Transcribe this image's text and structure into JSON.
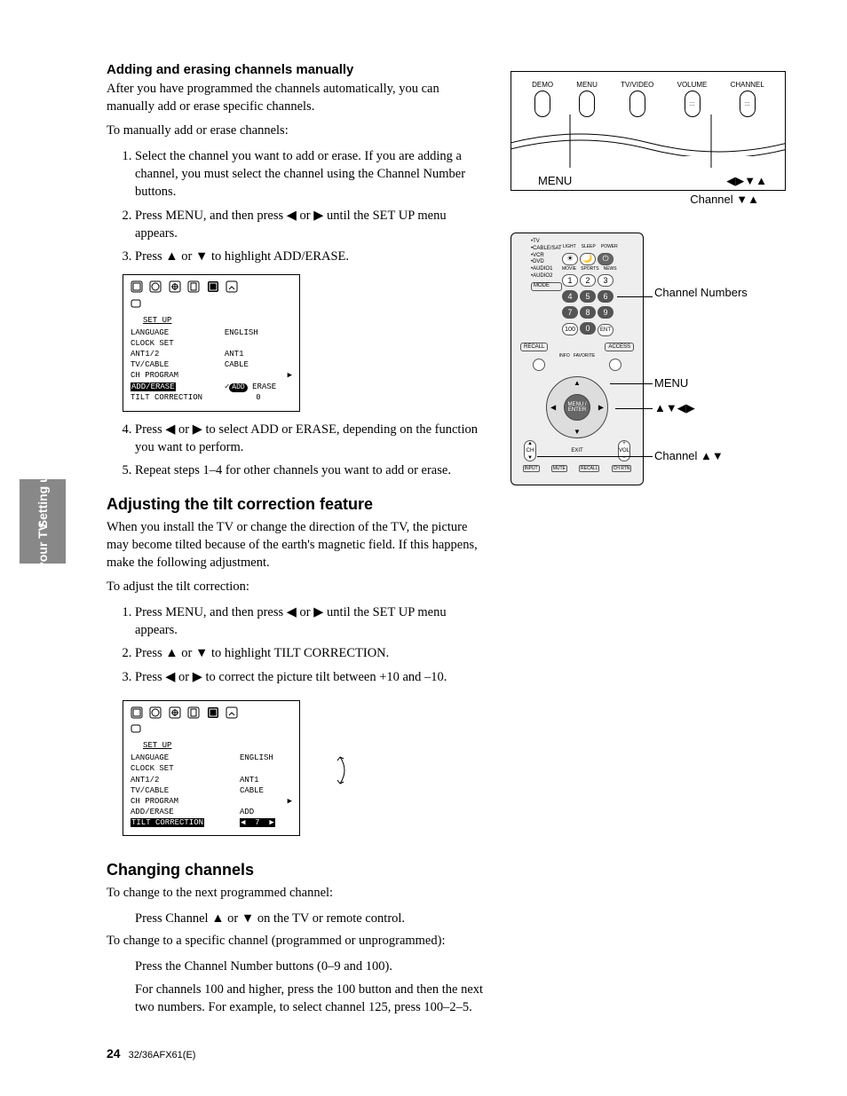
{
  "sideTab": {
    "line1": "Setting up",
    "line2": "your TV"
  },
  "sec1": {
    "heading": "Adding and erasing channels manually",
    "intro": "After you have programmed the channels automatically, you can manually add or erase specific channels.",
    "lead": "To manually add or erase channels:",
    "step1": "Select the channel you want to add or erase. If you are adding a channel, you must select the channel using the Channel Number buttons.",
    "step2a": "Press MENU, and then press ",
    "step2b": " or ",
    "step2c": " until the SET UP menu appears.",
    "step3a": "Press ",
    "step3b": " or ",
    "step3c": " to highlight ADD/ERASE.",
    "step4a": "Press ",
    "step4b": " or ",
    "step4c": " to select ADD or ERASE, depending on the function you want to perform.",
    "step5": "Repeat steps 1–4 for other channels you want to add or erase."
  },
  "osd1": {
    "title": "SET UP",
    "items": [
      {
        "l": "LANGUAGE",
        "r": "ENGLISH"
      },
      {
        "l": "CLOCK SET",
        "r": ""
      },
      {
        "l": "ANT1/2",
        "r": "ANT1"
      },
      {
        "l": "TV/CABLE",
        "r": "CABLE"
      },
      {
        "l": "CH PROGRAM",
        "r": "▶"
      }
    ],
    "hlRow": {
      "l": "ADD/ERASE",
      "a": "ADD",
      "b": "ERASE"
    },
    "last": {
      "l": "TILT CORRECTION",
      "r": "0"
    }
  },
  "sec2": {
    "heading": "Adjusting the tilt correction feature",
    "intro": "When you install the TV or change the direction of the TV, the picture may become tilted because of the earth's magnetic field. If this happens, make the following adjustment.",
    "lead": "To adjust the tilt correction:",
    "step1a": "Press MENU, and then press ",
    "step1b": " or ",
    "step1c": " until the SET UP menu appears.",
    "step2a": "Press ",
    "step2b": " or ",
    "step2c": " to highlight TILT CORRECTION.",
    "step3a": "Press ",
    "step3b": " or ",
    "step3c": " to correct the picture tilt between +10 and –10."
  },
  "osd2": {
    "title": "SET UP",
    "items": [
      {
        "l": "LANGUAGE",
        "r": "ENGLISH"
      },
      {
        "l": "CLOCK SET",
        "r": ""
      },
      {
        "l": "ANT1/2",
        "r": "ANT1"
      },
      {
        "l": "TV/CABLE",
        "r": "CABLE"
      },
      {
        "l": "CH PROGRAM",
        "r": "▶"
      },
      {
        "l": "ADD/ERASE",
        "r": "ADD"
      }
    ],
    "hlRow": {
      "l": "TILT CORRECTION",
      "r": "7"
    }
  },
  "sec3": {
    "heading": "Changing channels",
    "p1": "To change to the next programmed channel:",
    "i1a": "Press Channel ",
    "i1b": " or ",
    "i1c": " on the TV or remote control.",
    "p2": "To change to a specific channel (programmed or unprogrammed):",
    "i2": "Press the Channel Number buttons (0–9 and 100).",
    "i3": "For channels 100 and higher, press the 100 button and then the next two numbers. For example, to select channel 125, press 100–2–5."
  },
  "tvDiagram": {
    "buttons": [
      "DEMO",
      "MENU",
      "TV/VIDEO",
      "VOLUME",
      "CHANNEL"
    ],
    "labelLeft": "MENU",
    "labelRightArrows": "◀▶▼▲",
    "labelRightCh": "Channel ▼▲"
  },
  "remoteDiagram": {
    "sideLabels": [
      "•TV",
      "•CABLE/SAT",
      "•VCR",
      "•DVD",
      "•AUDIO1",
      "•AUDIO2"
    ],
    "mode": "MODE",
    "topRow": [
      "LIGHT",
      "SLEEP",
      "⏻"
    ],
    "topRowSub": [
      "MOVIE",
      "SPORTS",
      "NEWS"
    ],
    "nums": [
      "1",
      "2",
      "3",
      "4",
      "5",
      "6",
      "7",
      "8",
      "9",
      "100",
      "0",
      "ENT"
    ],
    "mid": [
      "RECALL",
      "ACCESS"
    ],
    "ringCenter": "MENU / ENTER",
    "lowerBtns": [
      "CH",
      "EXIT",
      "VOL"
    ],
    "bottomRow": [
      "INPUT",
      "MUTE",
      "RECALL",
      "CH RTN"
    ],
    "annot1": "Channel Numbers",
    "annot2": "MENU",
    "annot3": "▲▼◀▶",
    "annot4": "Channel ▲▼"
  },
  "footer": {
    "page": "24",
    "doc": "32/36AFX61(E)"
  },
  "glyphs": {
    "left": "◀",
    "right": "▶",
    "up": "▲",
    "down": "▼"
  }
}
